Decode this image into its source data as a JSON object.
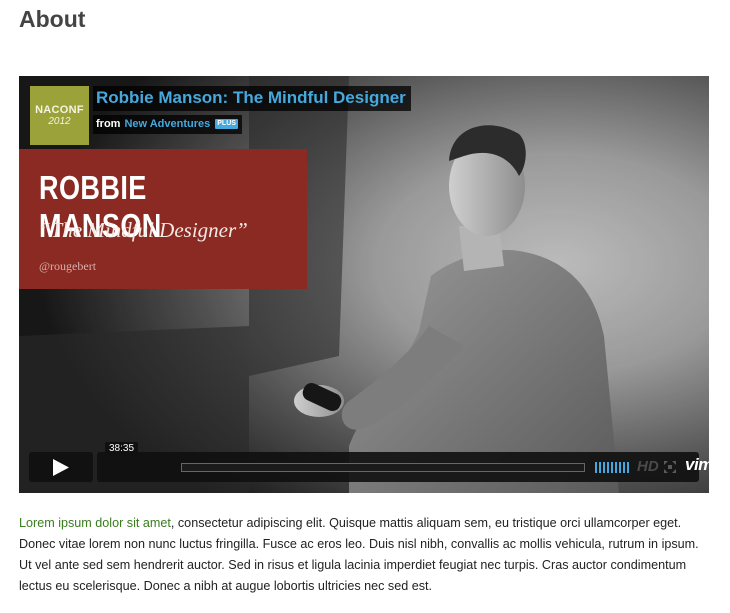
{
  "page": {
    "title": "About"
  },
  "video": {
    "badge": {
      "line1": "NACONF",
      "line2": "2012"
    },
    "title": "Robbie Manson: The Mindful Designer",
    "byline_prefix": "from",
    "channel": "New Adventures",
    "channel_badge": "PLUS",
    "overlay": {
      "name": "ROBBIE MANSON",
      "talk": "“The Mindful Designer”",
      "handle": "@rougebert"
    },
    "controls": {
      "timecode": "38:35",
      "progress": 0,
      "play_icon": "play-icon",
      "hd_label": "HD",
      "fullscreen_icon": "fullscreen-icon",
      "logo": "vimeo"
    },
    "accent_color": "#46a9de"
  },
  "content": {
    "lead_text": "Lorem ipsum dolor sit amet",
    "paragraph": ", consectetur adipiscing elit. Quisque mattis aliquam sem, eu tristique orci ullamcorper eget. Donec vitae lorem non nunc luctus fringilla. Fusce ac eros leo. Duis nisl nibh, convallis ac mollis vehicula, rutrum in ipsum. Ut vel ante sed sem hendrerit auctor. Sed in risus et ligula lacinia imperdiet feugiat nec turpis. Cras auctor condimentum lectus eu scelerisque. Donec a nibh at augue lobortis ultricies nec sed est."
  }
}
